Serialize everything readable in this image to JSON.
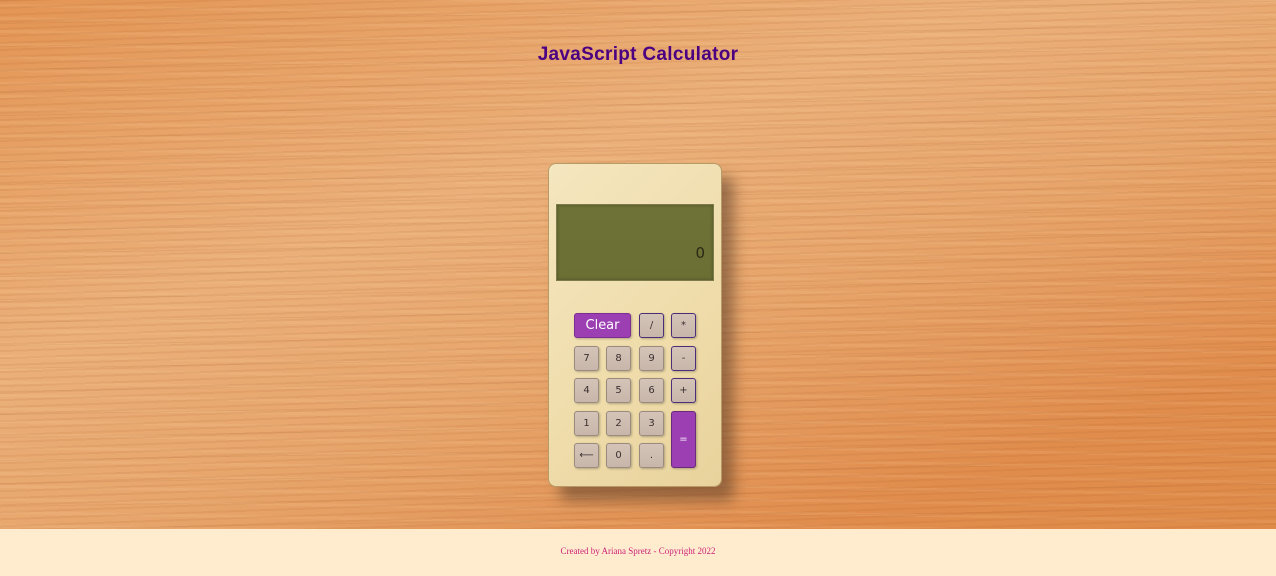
{
  "header": {
    "title": "JavaScript Calculator"
  },
  "calculator": {
    "display_value": "0",
    "buttons": {
      "clear": "Clear",
      "divide": "/",
      "multiply": "*",
      "seven": "7",
      "eight": "8",
      "nine": "9",
      "subtract": "-",
      "four": "4",
      "five": "5",
      "six": "6",
      "add": "+",
      "one": "1",
      "two": "2",
      "three": "3",
      "equals": "=",
      "backspace": "⟵",
      "zero": "0",
      "decimal": "."
    }
  },
  "footer": {
    "text": "Created by Ariana Spretz - Copyright 2022"
  },
  "colors": {
    "title": "#4b0082",
    "accent_button": "#9b3fb2",
    "display_background": "#6e7236",
    "footer_background": "#ffeccf",
    "footer_text": "#cc2277"
  }
}
